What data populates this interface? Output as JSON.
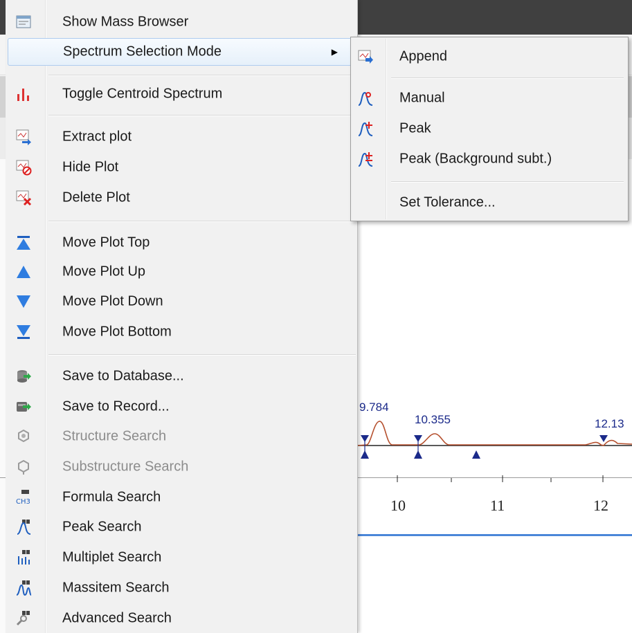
{
  "colors": {
    "accent_blue": "#2a5bd7",
    "peak_red": "#c0392b",
    "menu_bg": "#f1f1f1",
    "highlight_border": "#aecbee"
  },
  "menu": {
    "items": [
      {
        "label": "Show Mass Browser",
        "icon": "mass-browser-icon",
        "enabled": true
      },
      {
        "label": "Spectrum Selection Mode",
        "icon": "none",
        "enabled": true,
        "has_submenu": true,
        "highlighted": true
      },
      {
        "label": "Toggle Centroid Spectrum",
        "icon": "centroid-bars-icon",
        "enabled": true
      },
      {
        "label": "Extract plot",
        "icon": "extract-plot-icon",
        "enabled": true
      },
      {
        "label": "Hide Plot",
        "icon": "hide-plot-icon",
        "enabled": true
      },
      {
        "label": "Delete Plot",
        "icon": "delete-plot-icon",
        "enabled": true
      },
      {
        "label": "Move Plot Top",
        "icon": "move-top-icon",
        "enabled": true
      },
      {
        "label": "Move Plot Up",
        "icon": "move-up-icon",
        "enabled": true
      },
      {
        "label": "Move Plot Down",
        "icon": "move-down-icon",
        "enabled": true
      },
      {
        "label": "Move Plot Bottom",
        "icon": "move-bottom-icon",
        "enabled": true
      },
      {
        "label": "Save to Database...",
        "icon": "save-database-icon",
        "enabled": true
      },
      {
        "label": "Save to Record...",
        "icon": "save-record-icon",
        "enabled": true
      },
      {
        "label": "Structure Search",
        "icon": "structure-search-icon",
        "enabled": false
      },
      {
        "label": "Substructure Search",
        "icon": "substructure-search-icon",
        "enabled": false
      },
      {
        "label": "Formula Search",
        "icon": "formula-search-icon",
        "enabled": true
      },
      {
        "label": "Peak Search",
        "icon": "peak-search-icon",
        "enabled": true
      },
      {
        "label": "Multiplet Search",
        "icon": "multiplet-search-icon",
        "enabled": true
      },
      {
        "label": "Massitem Search",
        "icon": "massitem-search-icon",
        "enabled": true
      },
      {
        "label": "Advanced Search",
        "icon": "advanced-search-icon",
        "enabled": true
      }
    ]
  },
  "submenu": {
    "items": [
      {
        "label": "Append",
        "icon": "append-icon"
      },
      {
        "label": "Manual",
        "icon": "manual-peak-icon"
      },
      {
        "label": "Peak",
        "icon": "peak-icon"
      },
      {
        "label": "Peak (Background subt.)",
        "icon": "peak-background-icon"
      },
      {
        "label": "Set Tolerance...",
        "icon": "none"
      }
    ]
  },
  "chart": {
    "peak_labels": [
      "9.784",
      "10.355",
      "12.13"
    ],
    "x_ticks": [
      "10",
      "11",
      "12"
    ]
  }
}
